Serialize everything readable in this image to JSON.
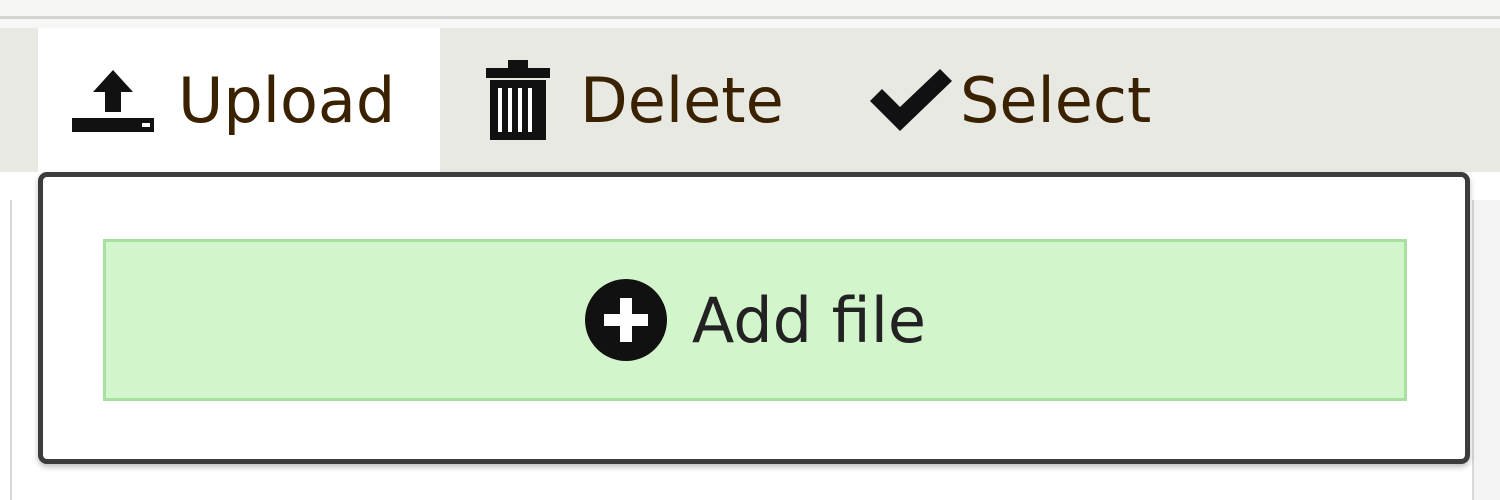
{
  "toolbar": {
    "upload": {
      "label": "Upload",
      "icon": "upload-icon",
      "active": true
    },
    "delete": {
      "label": "Delete",
      "icon": "trash-icon"
    },
    "select": {
      "label": "Select",
      "icon": "checkmark-icon"
    }
  },
  "popup": {
    "add_file": {
      "label": "Add file",
      "icon": "plus-circle-icon"
    }
  },
  "colors": {
    "toolbar_bg": "#e9e9e3",
    "toolbar_text": "#3a2200",
    "add_file_bg": "#d3f5cc",
    "add_file_border": "#a9e0a0",
    "popup_border": "#3c3c3c"
  }
}
